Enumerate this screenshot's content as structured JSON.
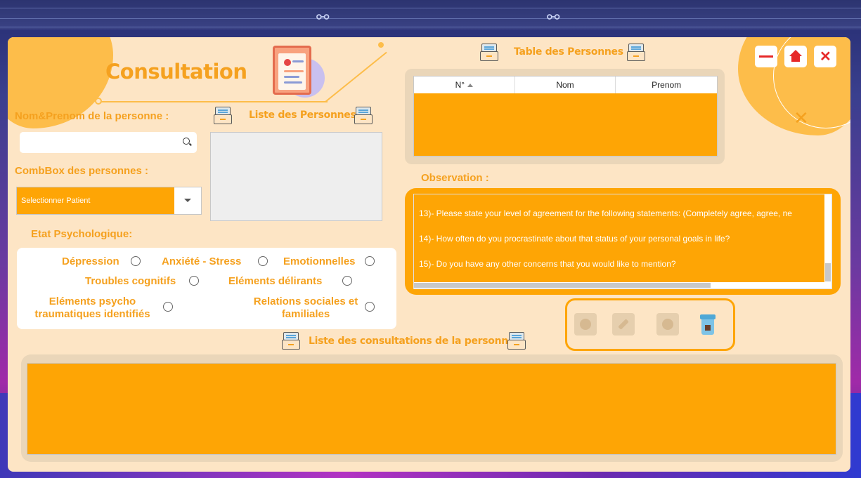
{
  "window": {
    "title": "Consultation",
    "controls": {
      "minimize": "—",
      "close": "✕"
    }
  },
  "search": {
    "label": "Nom&Prenom  de la personne :",
    "value": "",
    "placeholder": ""
  },
  "list_personnes": {
    "title": "Liste des Personnes"
  },
  "combo": {
    "label": "CombBox des personnes :",
    "selected": "Selectionner Patient"
  },
  "etat": {
    "label": "Etat Psychologique:",
    "options": [
      "Dépression",
      "Anxiété - Stress",
      "Emotionnelles",
      "Troubles cognitifs",
      "Eléments délirants",
      "Eléments psycho traumatiques identifiés",
      "Relations sociales et familiales"
    ]
  },
  "table_personnes": {
    "title": "Table des Personnes",
    "columns": [
      "N°",
      "Nom",
      "Prenom"
    ]
  },
  "observation": {
    "label": "Observation :",
    "lines": [
      "13)- Please state your level of agreement for the following statements: (Completely agree, agree, ne",
      "14)- How often do you procrastinate about that status of your personal goals in life?",
      "15)- Do you have any other concerns that you would like to mention?"
    ]
  },
  "consultations": {
    "title": "Liste des consultations de la personne"
  },
  "icons": {
    "add": "plus-circle-icon",
    "edit": "pencil-icon",
    "cancel": "x-circle-icon",
    "delete": "trash-icon",
    "home": "home-icon"
  },
  "colors": {
    "accent": "#fea505",
    "panel": "#fde5c5",
    "text_orange": "#f5a11f",
    "window_red": "#e62828"
  }
}
